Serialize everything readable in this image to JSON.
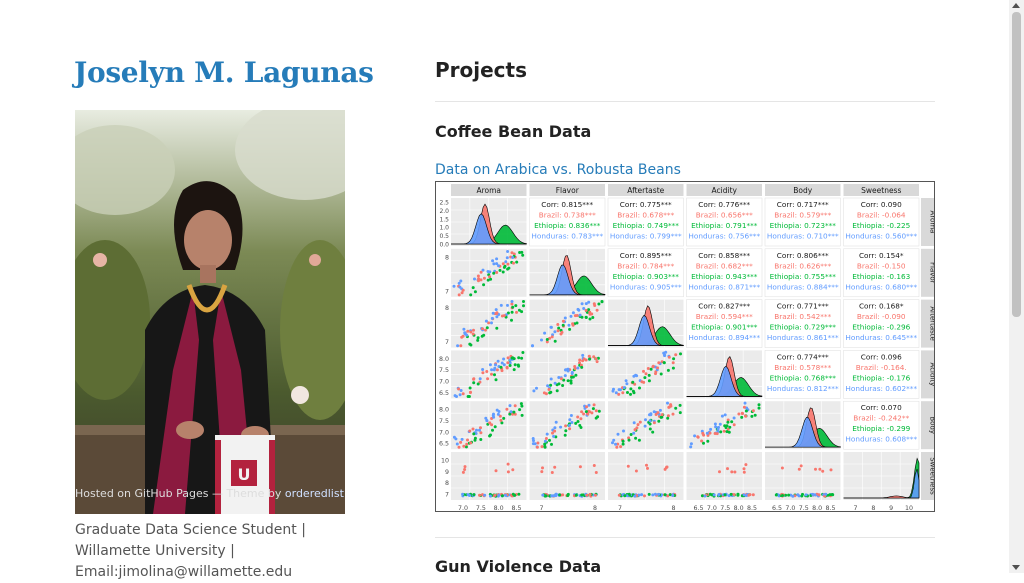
{
  "sidebar": {
    "name": "Joselyn M. Lagunas",
    "footer_hosted": "Hosted on GitHub Pages — Theme by ",
    "footer_theme": "orderedlist",
    "bio_line1": "Graduate Data Science Student |",
    "bio_line2": "Willamette University |",
    "bio_line3": "Email:jimolina@willamette.edu"
  },
  "main": {
    "heading": "Projects",
    "project1_title": "Coffee Bean Data",
    "project1_link": "Data on Arabica vs. Robusta Beans",
    "project2_title": "Gun Violence Data"
  },
  "chart_data": {
    "type": "scatter",
    "variables": [
      "Aroma",
      "Flavor",
      "Aftertaste",
      "Acidity",
      "Body",
      "Sweetness"
    ],
    "groups": [
      {
        "name": "Brazil",
        "color": "#F8766D"
      },
      {
        "name": "Ethiopia",
        "color": "#00BA38"
      },
      {
        "name": "Honduras",
        "color": "#619CFF"
      }
    ],
    "correlations": [
      {
        "row": 0,
        "col": 1,
        "lines": [
          "Corr: 0.815***",
          "Brazil: 0.738***",
          "Ethiopia: 0.836***",
          "Honduras: 0.783***"
        ]
      },
      {
        "row": 0,
        "col": 2,
        "lines": [
          "Corr: 0.775***",
          "Brazil: 0.678***",
          "Ethiopia: 0.749***",
          "Honduras: 0.799***"
        ]
      },
      {
        "row": 0,
        "col": 3,
        "lines": [
          "Corr: 0.776***",
          "Brazil: 0.656***",
          "Ethiopia: 0.791***",
          "Honduras: 0.756***"
        ]
      },
      {
        "row": 0,
        "col": 4,
        "lines": [
          "Corr: 0.717***",
          "Brazil: 0.579***",
          "Ethiopia: 0.723***",
          "Honduras: 0.710***"
        ]
      },
      {
        "row": 0,
        "col": 5,
        "lines": [
          "Corr: 0.090",
          "Brazil: -0.064",
          "Ethiopia: -0.225",
          "Honduras: 0.560***"
        ]
      },
      {
        "row": 1,
        "col": 2,
        "lines": [
          "Corr: 0.895***",
          "Brazil: 0.784***",
          "Ethiopia: 0.903***",
          "Honduras: 0.905***"
        ]
      },
      {
        "row": 1,
        "col": 3,
        "lines": [
          "Corr: 0.858***",
          "Brazil: 0.682***",
          "Ethiopia: 0.943***",
          "Honduras: 0.871***"
        ]
      },
      {
        "row": 1,
        "col": 4,
        "lines": [
          "Corr: 0.806***",
          "Brazil: 0.626***",
          "Ethiopia: 0.755***",
          "Honduras: 0.884***"
        ]
      },
      {
        "row": 1,
        "col": 5,
        "lines": [
          "Corr: 0.154*",
          "Brazil: -0.150",
          "Ethiopia: -0.163",
          "Honduras: 0.680***"
        ]
      },
      {
        "row": 2,
        "col": 3,
        "lines": [
          "Corr: 0.827***",
          "Brazil: 0.594***",
          "Ethiopia: 0.901***",
          "Honduras: 0.894***"
        ]
      },
      {
        "row": 2,
        "col": 4,
        "lines": [
          "Corr: 0.771***",
          "Brazil: 0.542***",
          "Ethiopia: 0.729***",
          "Honduras: 0.861***"
        ]
      },
      {
        "row": 2,
        "col": 5,
        "lines": [
          "Corr: 0.168*",
          "Brazil: -0.090",
          "Ethiopia: -0.296",
          "Honduras: 0.645***"
        ]
      },
      {
        "row": 3,
        "col": 4,
        "lines": [
          "Corr: 0.774***",
          "Brazil: 0.578***",
          "Ethiopia: 0.768***",
          "Honduras: 0.812***"
        ]
      },
      {
        "row": 3,
        "col": 5,
        "lines": [
          "Corr: 0.096",
          "Brazil: -0.164.",
          "Ethiopia: -0.176",
          "Honduras: 0.602***"
        ]
      },
      {
        "row": 4,
        "col": 5,
        "lines": [
          "Corr: 0.070",
          "Brazil: -0.242**",
          "Ethiopia: -0.299",
          "Honduras: 0.608***"
        ]
      }
    ],
    "row1_y_ticks": [
      "2.5",
      "2.0",
      "1.5",
      "1.0",
      "0.5",
      "0.0"
    ],
    "y_ticks_rows": [
      [
        "8",
        "7"
      ],
      [
        "8",
        "7"
      ],
      [
        "8.0",
        "7.5",
        "7.0",
        "6.5"
      ],
      [
        "8.0",
        "7.5",
        "7.0",
        "6.5"
      ],
      [
        "10",
        "9",
        "8",
        "7"
      ]
    ],
    "x_ticks_cols": [
      [
        "7.0",
        "7.5",
        "8.0",
        "8.5"
      ],
      [
        "7",
        "8"
      ],
      [
        "7",
        "8"
      ],
      [
        "6.5",
        "7.0",
        "7.5",
        "8.0",
        "8.5"
      ],
      [
        "6.5",
        "7.0",
        "7.5",
        "8.0",
        "8.5"
      ],
      [
        "7",
        "8",
        "9",
        "10"
      ]
    ]
  },
  "colors": {
    "accent": "#267CB9"
  }
}
